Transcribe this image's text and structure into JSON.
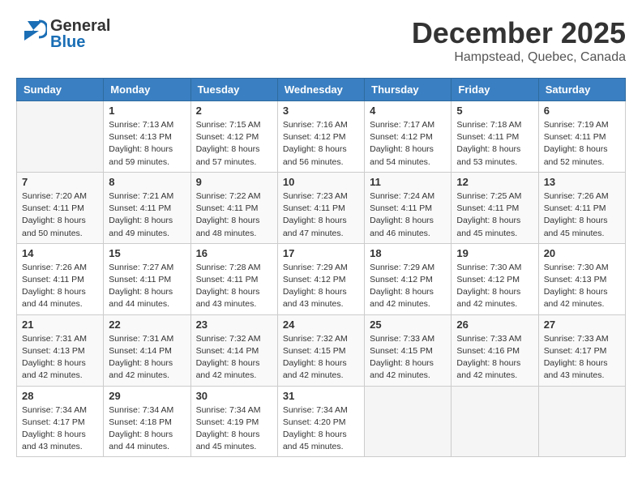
{
  "header": {
    "logo": {
      "general": "General",
      "blue": "Blue"
    },
    "title": "December 2025",
    "location": "Hampstead, Quebec, Canada"
  },
  "weekdays": [
    "Sunday",
    "Monday",
    "Tuesday",
    "Wednesday",
    "Thursday",
    "Friday",
    "Saturday"
  ],
  "weeks": [
    [
      {
        "day": "",
        "info": ""
      },
      {
        "day": "1",
        "info": "Sunrise: 7:13 AM\nSunset: 4:13 PM\nDaylight: 8 hours\nand 59 minutes."
      },
      {
        "day": "2",
        "info": "Sunrise: 7:15 AM\nSunset: 4:12 PM\nDaylight: 8 hours\nand 57 minutes."
      },
      {
        "day": "3",
        "info": "Sunrise: 7:16 AM\nSunset: 4:12 PM\nDaylight: 8 hours\nand 56 minutes."
      },
      {
        "day": "4",
        "info": "Sunrise: 7:17 AM\nSunset: 4:12 PM\nDaylight: 8 hours\nand 54 minutes."
      },
      {
        "day": "5",
        "info": "Sunrise: 7:18 AM\nSunset: 4:11 PM\nDaylight: 8 hours\nand 53 minutes."
      },
      {
        "day": "6",
        "info": "Sunrise: 7:19 AM\nSunset: 4:11 PM\nDaylight: 8 hours\nand 52 minutes."
      }
    ],
    [
      {
        "day": "7",
        "info": "Sunrise: 7:20 AM\nSunset: 4:11 PM\nDaylight: 8 hours\nand 50 minutes."
      },
      {
        "day": "8",
        "info": "Sunrise: 7:21 AM\nSunset: 4:11 PM\nDaylight: 8 hours\nand 49 minutes."
      },
      {
        "day": "9",
        "info": "Sunrise: 7:22 AM\nSunset: 4:11 PM\nDaylight: 8 hours\nand 48 minutes."
      },
      {
        "day": "10",
        "info": "Sunrise: 7:23 AM\nSunset: 4:11 PM\nDaylight: 8 hours\nand 47 minutes."
      },
      {
        "day": "11",
        "info": "Sunrise: 7:24 AM\nSunset: 4:11 PM\nDaylight: 8 hours\nand 46 minutes."
      },
      {
        "day": "12",
        "info": "Sunrise: 7:25 AM\nSunset: 4:11 PM\nDaylight: 8 hours\nand 45 minutes."
      },
      {
        "day": "13",
        "info": "Sunrise: 7:26 AM\nSunset: 4:11 PM\nDaylight: 8 hours\nand 45 minutes."
      }
    ],
    [
      {
        "day": "14",
        "info": "Sunrise: 7:26 AM\nSunset: 4:11 PM\nDaylight: 8 hours\nand 44 minutes."
      },
      {
        "day": "15",
        "info": "Sunrise: 7:27 AM\nSunset: 4:11 PM\nDaylight: 8 hours\nand 44 minutes."
      },
      {
        "day": "16",
        "info": "Sunrise: 7:28 AM\nSunset: 4:11 PM\nDaylight: 8 hours\nand 43 minutes."
      },
      {
        "day": "17",
        "info": "Sunrise: 7:29 AM\nSunset: 4:12 PM\nDaylight: 8 hours\nand 43 minutes."
      },
      {
        "day": "18",
        "info": "Sunrise: 7:29 AM\nSunset: 4:12 PM\nDaylight: 8 hours\nand 42 minutes."
      },
      {
        "day": "19",
        "info": "Sunrise: 7:30 AM\nSunset: 4:12 PM\nDaylight: 8 hours\nand 42 minutes."
      },
      {
        "day": "20",
        "info": "Sunrise: 7:30 AM\nSunset: 4:13 PM\nDaylight: 8 hours\nand 42 minutes."
      }
    ],
    [
      {
        "day": "21",
        "info": "Sunrise: 7:31 AM\nSunset: 4:13 PM\nDaylight: 8 hours\nand 42 minutes."
      },
      {
        "day": "22",
        "info": "Sunrise: 7:31 AM\nSunset: 4:14 PM\nDaylight: 8 hours\nand 42 minutes."
      },
      {
        "day": "23",
        "info": "Sunrise: 7:32 AM\nSunset: 4:14 PM\nDaylight: 8 hours\nand 42 minutes."
      },
      {
        "day": "24",
        "info": "Sunrise: 7:32 AM\nSunset: 4:15 PM\nDaylight: 8 hours\nand 42 minutes."
      },
      {
        "day": "25",
        "info": "Sunrise: 7:33 AM\nSunset: 4:15 PM\nDaylight: 8 hours\nand 42 minutes."
      },
      {
        "day": "26",
        "info": "Sunrise: 7:33 AM\nSunset: 4:16 PM\nDaylight: 8 hours\nand 42 minutes."
      },
      {
        "day": "27",
        "info": "Sunrise: 7:33 AM\nSunset: 4:17 PM\nDaylight: 8 hours\nand 43 minutes."
      }
    ],
    [
      {
        "day": "28",
        "info": "Sunrise: 7:34 AM\nSunset: 4:17 PM\nDaylight: 8 hours\nand 43 minutes."
      },
      {
        "day": "29",
        "info": "Sunrise: 7:34 AM\nSunset: 4:18 PM\nDaylight: 8 hours\nand 44 minutes."
      },
      {
        "day": "30",
        "info": "Sunrise: 7:34 AM\nSunset: 4:19 PM\nDaylight: 8 hours\nand 45 minutes."
      },
      {
        "day": "31",
        "info": "Sunrise: 7:34 AM\nSunset: 4:20 PM\nDaylight: 8 hours\nand 45 minutes."
      },
      {
        "day": "",
        "info": ""
      },
      {
        "day": "",
        "info": ""
      },
      {
        "day": "",
        "info": ""
      }
    ]
  ]
}
